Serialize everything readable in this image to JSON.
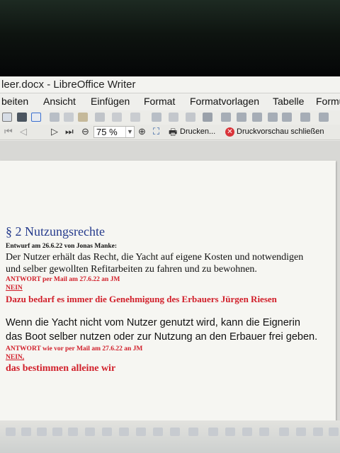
{
  "window": {
    "title": "leer.docx - LibreOffice Writer"
  },
  "menu": [
    "beiten",
    "Ansicht",
    "Einfügen",
    "Format",
    "Formatvorlagen",
    "Tabelle",
    "Formu"
  ],
  "preview_toolbar": {
    "zoom": "75 %",
    "print_label": "Drucken...",
    "close_label": "Druckvorschau schließen"
  },
  "document": {
    "heading": "§ 2 Nutzungsrechte",
    "draft_meta": "Entwurf am 26.6.22 von Jonas Manke:",
    "para1_line1": "Der Nutzer erhält das Recht, die Yacht auf eigene Kosten und notwendigen",
    "para1_line2": "und selber gewollten Refitarbeiten zu fahren und zu bewohnen.",
    "answer1_meta": "ANTWORT per Mail am 27.6.22 an JM",
    "answer1_no": "NEIN",
    "answer1_text": "Dazu bedarf es immer die Genehmigung des Erbauers Jürgen Riesen",
    "para2_line1": "Wenn die Yacht nicht vom Nutzer genutzt wird, kann die Eignerin",
    "para2_line2": "das Boot selber nutzen oder zur Nutzung an den Erbauer frei geben.",
    "answer2_meta": "ANTWORT wie vor  per Mail am 27.6.22 an JM",
    "answer2_no": "NEIN,",
    "answer2_text": "das bestimmen alleine wir"
  },
  "colors": {
    "heading": "#243a8c",
    "answer": "#d11f2a",
    "page": "#f6f6f2"
  }
}
